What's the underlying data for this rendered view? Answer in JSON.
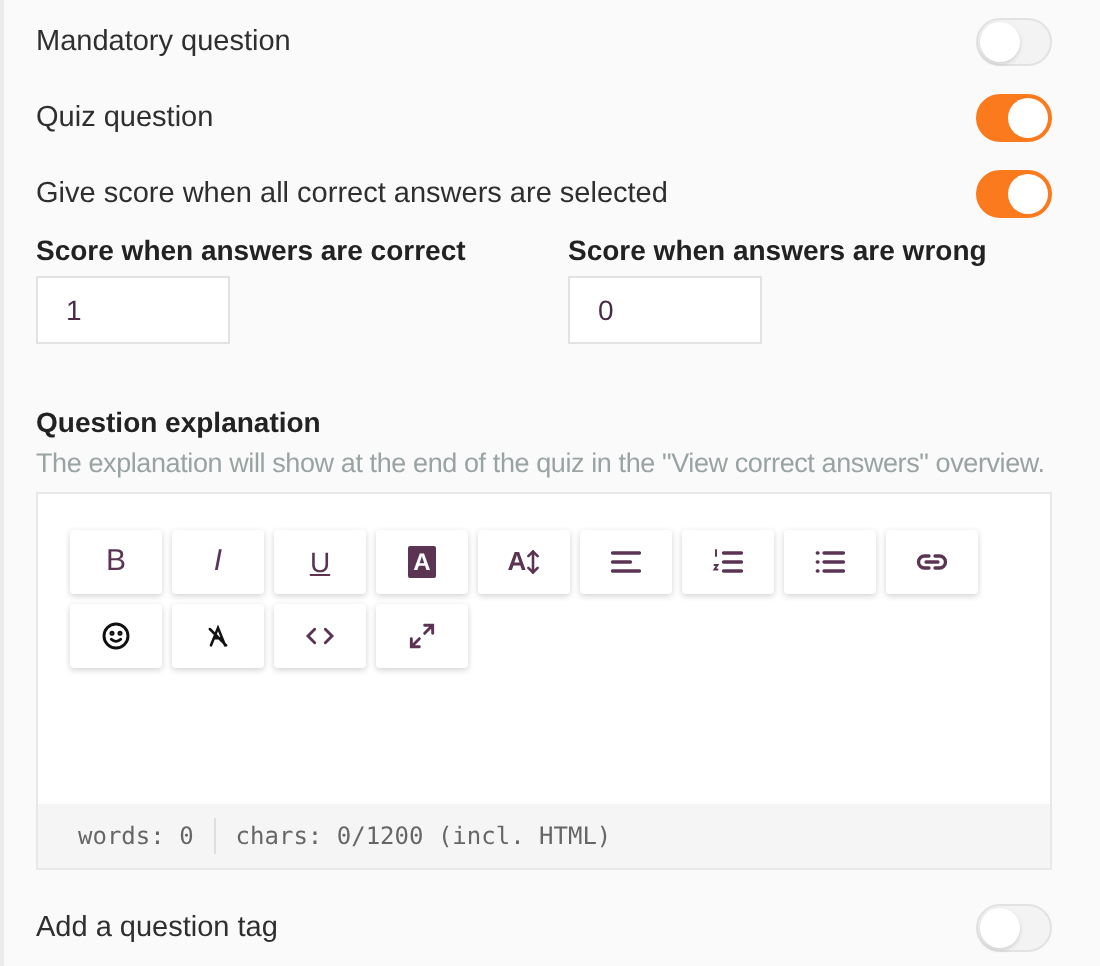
{
  "toggles": [
    {
      "label": "Mandatory question",
      "on": false
    },
    {
      "label": "Quiz question",
      "on": true
    },
    {
      "label": "Give score when all correct answers are selected",
      "on": true
    }
  ],
  "scores": [
    {
      "label": "Score when answers are correct",
      "value": "1"
    },
    {
      "label": "Score when answers are wrong",
      "value": "0"
    }
  ],
  "explanation": {
    "title": "Question explanation",
    "description": "The explanation will show at the end of the quiz in the \"View correct answers\" overview.",
    "toolbar": [
      {
        "kind": "bold",
        "label": "B"
      },
      {
        "kind": "italic",
        "label": "I"
      },
      {
        "kind": "underline",
        "label": "U"
      },
      {
        "kind": "highlight",
        "label": "A"
      },
      {
        "kind": "font-size",
        "label": "A"
      },
      {
        "kind": "align"
      },
      {
        "kind": "ordered-list"
      },
      {
        "kind": "bullet-list"
      },
      {
        "kind": "link"
      },
      {
        "kind": "emoji"
      },
      {
        "kind": "clear-format"
      },
      {
        "kind": "code"
      },
      {
        "kind": "fullscreen"
      }
    ],
    "words": "words: 0",
    "chars": "chars: 0/1200 (incl. HTML)"
  },
  "tag_toggle": {
    "label": "Add a question tag",
    "on": false
  }
}
